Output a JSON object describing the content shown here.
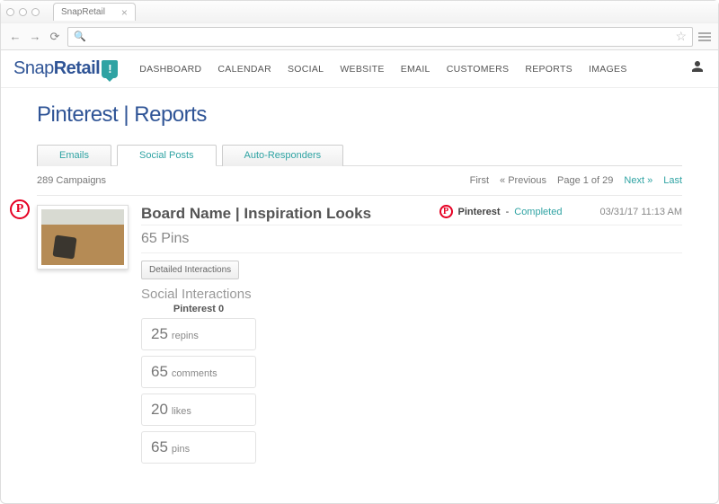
{
  "browser": {
    "tab_title": "SnapRetail"
  },
  "brand": {
    "part1": "Snap",
    "part2": "Retail",
    "badge": "!"
  },
  "nav": {
    "dashboard": "DASHBOARD",
    "calendar": "CALENDAR",
    "social": "SOCIAL",
    "website": "WEBSITE",
    "email": "EMAIL",
    "customers": "CUSTOMERS",
    "reports": "REPORTS",
    "images": "IMAGES"
  },
  "page": {
    "title": "Pinterest | Reports"
  },
  "tabs": {
    "emails": "Emails",
    "social_posts": "Social Posts",
    "auto_responders": "Auto-Responders"
  },
  "listHeader": {
    "count": "289 Campaigns",
    "first": "First",
    "prev": "« Previous",
    "page": "Page 1 of 29",
    "next": "Next »",
    "last": "Last"
  },
  "card": {
    "title": "Board Name | Inspiration Looks",
    "network": "Pinterest",
    "status_sep": " - ",
    "status": "Completed",
    "date": "03/31/17 11:13 AM",
    "pins": "65 Pins",
    "btn_detail": "Detailed Interactions",
    "section_label": "Social Interactions",
    "sublabel": "Pinterest 0",
    "metrics": {
      "repins": {
        "num": "25",
        "label": "repins"
      },
      "comments": {
        "num": "65",
        "label": "comments"
      },
      "likes": {
        "num": "20",
        "label": "likes"
      },
      "pins_m": {
        "num": "65",
        "label": "pins"
      }
    }
  }
}
